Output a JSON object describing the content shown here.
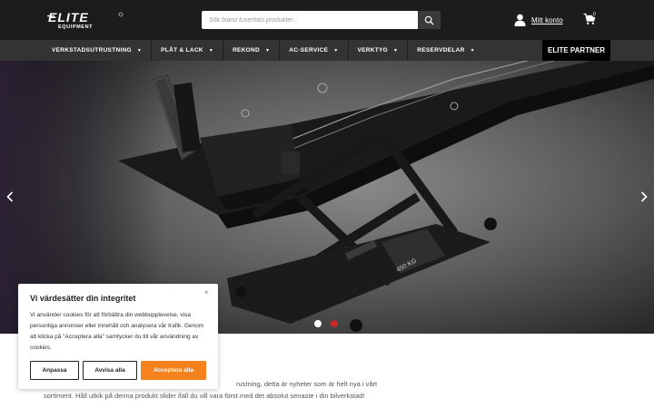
{
  "header": {
    "logo_text": "ELITE EQUIPMENT",
    "search": {
      "placeholder": "Sök bland tusentals produkter..."
    },
    "account_label": "Mitt konto",
    "cart_count": "0"
  },
  "nav": {
    "items": [
      {
        "label": "VERKSTADSUTRUSTNING"
      },
      {
        "label": "PLÅT & LACK"
      },
      {
        "label": "REKOND"
      },
      {
        "label": "AC-SERVICE"
      },
      {
        "label": "VERKTYG"
      },
      {
        "label": "RESERVDELAR"
      }
    ],
    "partner_label": "ELITE PARTNER"
  },
  "hero": {
    "lift_label": "450 KG",
    "slides_total": 2,
    "active_slide": 1
  },
  "content": {
    "line1": "rustning, detta är nyheter som är helt nya i vårt",
    "line2": "sortiment. Håll utkik på denna produkt slider ifall du vill vara först med det absolut senaste i din bilverkstad!"
  },
  "cookie": {
    "title": "Vi värdesätter din integritet",
    "close": "×",
    "text": "Vi använder cookies för att förbättra din webbupplevelse, visa personliga annonser eller innehåll och analysera vår trafik. Genom att klicka på \"Acceptera alla\" samtycker du till vår användning av cookies.",
    "customize_label": "Anpassa",
    "reject_label": "Avvisa alla",
    "accept_label": "Acceptera alla"
  },
  "colors": {
    "topbar": "#1c1c1c",
    "navbar": "#333333",
    "accent": "#f5821f",
    "dot_inactive": "#c62828"
  }
}
